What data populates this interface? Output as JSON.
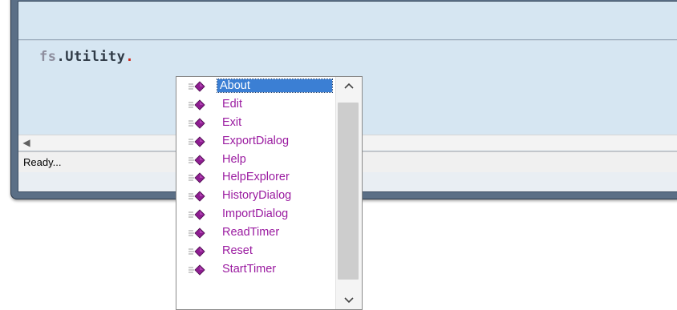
{
  "editor": {
    "code": {
      "namespace": "fs",
      "dot1": ".",
      "member": "Utility",
      "dot2": "."
    }
  },
  "statusbar": {
    "text": "Ready..."
  },
  "autocomplete": {
    "selected_index": 0,
    "items": [
      {
        "label": "About"
      },
      {
        "label": "Edit"
      },
      {
        "label": "Exit"
      },
      {
        "label": "ExportDialog"
      },
      {
        "label": "Help"
      },
      {
        "label": "HelpExplorer"
      },
      {
        "label": "HistoryDialog"
      },
      {
        "label": "ImportDialog"
      },
      {
        "label": "ReadTimer"
      },
      {
        "label": "Reset"
      },
      {
        "label": "StartTimer"
      }
    ],
    "scroll_up_icon": "chevron-up-icon",
    "scroll_down_icon": "chevron-down-icon",
    "item_icon": "method-icon"
  },
  "colors": {
    "item_text": "#9a1aa0",
    "selection": "#3b7fd4",
    "editor_bg": "#d6e6f2",
    "window_frame": "#5b6f86"
  }
}
